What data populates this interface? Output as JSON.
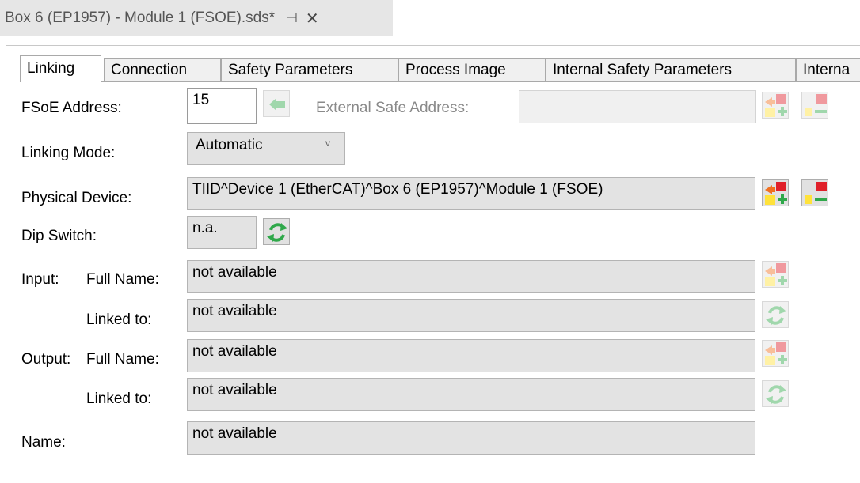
{
  "document_tab": {
    "title": "Box 6 (EP1957) - Module 1 (FSOE).sds*",
    "pin_glyph": "⊣",
    "close_glyph": "✕"
  },
  "tabs": [
    "Linking",
    "Connection",
    "Safety Parameters",
    "Process Image",
    "Internal Safety Parameters",
    "Interna"
  ],
  "active_tab": "Linking",
  "form": {
    "fsoe_address": {
      "label": "FSoE Address:",
      "value": "15"
    },
    "external_safe_address": {
      "label": "External Safe Address:",
      "value": ""
    },
    "linking_mode": {
      "label": "Linking Mode:",
      "value": "Automatic"
    },
    "physical_device": {
      "label": "Physical Device:",
      "value": "TIID^Device 1 (EtherCAT)^Box 6 (EP1957)^Module 1 (FSOE)"
    },
    "dip_switch": {
      "label": "Dip Switch:",
      "value": "n.a."
    },
    "input": {
      "group_label": "Input:",
      "full_name_label": "Full Name:",
      "full_name_value": "not available",
      "linked_to_label": "Linked to:",
      "linked_to_value": "not available"
    },
    "output": {
      "group_label": "Output:",
      "full_name_label": "Full Name:",
      "full_name_value": "not available",
      "linked_to_label": "Linked to:",
      "linked_to_value": "not available"
    },
    "name": {
      "label": "Name:",
      "value": "not available"
    }
  },
  "colors": {
    "field_bg": "#e3e3e3",
    "icon_red": "#e0202a",
    "icon_yellow": "#ffe23a",
    "icon_green": "#2fa84a",
    "icon_orange": "#f07020"
  },
  "icons": {
    "arrow": "left-arrow-icon",
    "link_add": "link-add-icon",
    "link_remove": "link-remove-icon",
    "refresh": "refresh-icon"
  }
}
